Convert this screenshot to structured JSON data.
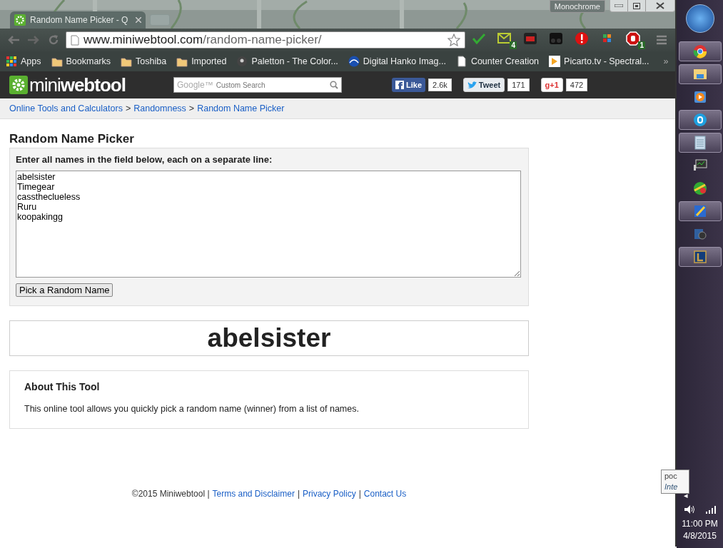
{
  "browser": {
    "tab_title": "Random Name Picker - Q",
    "theme_label": "Monochrome",
    "address_host": "www.miniwebtool.com",
    "address_path": "/random-name-picker/",
    "extensions": [
      {
        "kind": "spell"
      },
      {
        "kind": "mail",
        "badge": "4"
      },
      {
        "kind": "video"
      },
      {
        "kind": "mask"
      },
      {
        "kind": "alert"
      },
      {
        "kind": "tiles"
      },
      {
        "kind": "block",
        "badge": "1"
      }
    ],
    "bookmarks": [
      {
        "kind": "apps",
        "label": "Apps"
      },
      {
        "kind": "folder",
        "label": "Bookmarks"
      },
      {
        "kind": "folder",
        "label": "Toshiba"
      },
      {
        "kind": "folder",
        "label": "Imported"
      },
      {
        "kind": "pin",
        "label": "Paletton - The Color..."
      },
      {
        "kind": "wave",
        "label": "Digital Hanko Imag..."
      },
      {
        "kind": "page",
        "label": "Counter Creation"
      },
      {
        "kind": "play",
        "label": "Picarto.tv - Spectral..."
      }
    ],
    "bookmarks_overflow": "»"
  },
  "site": {
    "logo_light": "mini",
    "logo_bold": "webtool",
    "search_brand": "Google™",
    "search_placeholder": "Custom Search",
    "social": [
      {
        "kind": "facebook",
        "label": "Like",
        "count": "2.6k"
      },
      {
        "kind": "twitter",
        "label": "Tweet",
        "count": "171"
      },
      {
        "kind": "gplus",
        "label": "g+1",
        "count": "472"
      }
    ],
    "breadcrumbs": [
      "Online Tools and Calculators",
      "Randomness",
      "Random Name Picker"
    ],
    "breadcrumb_separator": ">"
  },
  "tool": {
    "title": "Random Name Picker",
    "instructions": "Enter all names in the field below, each on a separate line:",
    "names": "abelsister\nTimegear\ncasstheclueless\nRuru\nkoopakingg",
    "button": "Pick a Random Name",
    "result": "abelsister"
  },
  "about": {
    "title": "About This Tool",
    "text": "This online tool allows you quickly pick a random name (winner) from a list of names."
  },
  "footer": {
    "copyright": "©2015 Miniwebtool |",
    "links": [
      "Terms and Disclaimer",
      "Privacy Policy",
      "Contact Us"
    ],
    "separator": "|"
  },
  "taskbar": {
    "items": [
      {
        "kind": "chrome",
        "active": true
      },
      {
        "kind": "folder",
        "active": true
      },
      {
        "kind": "media",
        "active": false
      },
      {
        "kind": "chat",
        "active": true
      },
      {
        "kind": "notepad",
        "active": true
      },
      {
        "kind": "monitor",
        "active": false
      },
      {
        "kind": "ball",
        "active": false
      },
      {
        "kind": "pen",
        "active": true
      },
      {
        "kind": "camera",
        "active": false
      },
      {
        "kind": "game",
        "active": true
      }
    ],
    "tooltip": [
      "poc",
      "Inte"
    ],
    "tray_expand": "◂",
    "time": "11:00 PM",
    "date": "4/8/2015"
  }
}
